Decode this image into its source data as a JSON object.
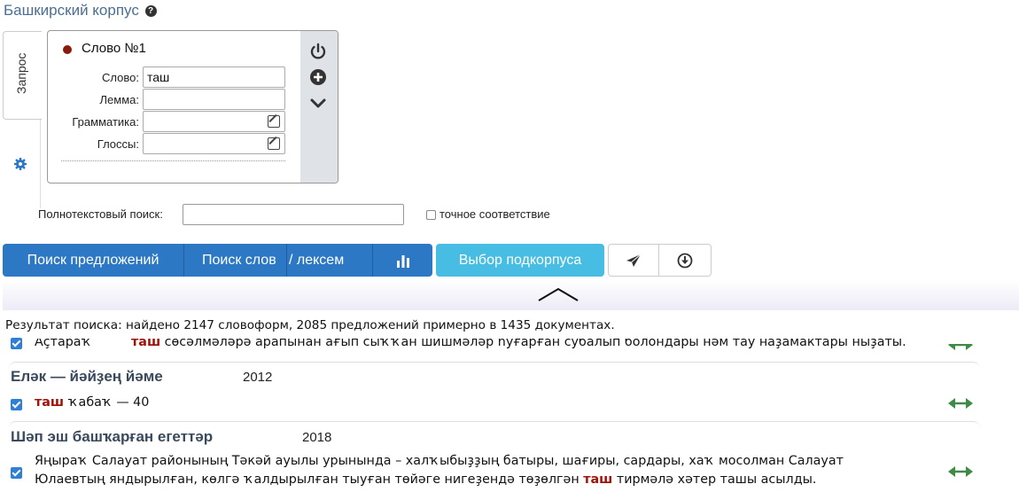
{
  "header": {
    "title": "Башкирский корпус",
    "help_icon": "question-circle-icon"
  },
  "tabs": [
    {
      "label": "Запрос",
      "active": true
    },
    {
      "label": "",
      "icon": "gear-icon"
    }
  ],
  "word_box": {
    "header": "Слово №1",
    "marker_color": "#8b1a0e",
    "fields": [
      {
        "label": "Слово:",
        "value": "таш",
        "has_edit": false
      },
      {
        "label": "Лемма:",
        "value": "",
        "has_edit": false
      },
      {
        "label": "Грамматика:",
        "value": "",
        "has_edit": true
      },
      {
        "label": "Глоссы:",
        "value": "",
        "has_edit": true
      }
    ],
    "side_icons": [
      "power-icon",
      "plus-circle-icon",
      "chevron-down-icon"
    ]
  },
  "fulltext": {
    "label": "Полнотекстовый поиск:",
    "value": "",
    "exact_label": "точное соответствие",
    "exact_checked": false
  },
  "toolbar": {
    "search_sentences": "Поиск предложений",
    "search_words_a": "Поиск слов",
    "search_words_b": "/ лексем",
    "stats_icon": "bar-chart-icon",
    "subcorpus": "Выбор подкорпуса",
    "share_icon": "paper-plane-icon",
    "download_icon": "download-circle-icon",
    "colors": {
      "primary": "#2d78c5",
      "info": "#47bde3"
    }
  },
  "result_summary": "Результат поиска: найдено 2147 словоформ, 2085 предложений примерно в 1435 документах.",
  "results": {
    "partial_line": {
      "before": "Аҫтараҡ",
      "hit": "таш",
      "after": " сөсәлмәләрә арапынан ағып сыҡҡан шишмәләр һуғарған субалып болондары нәм тау наҙамактары ныҙаты."
    },
    "docs": [
      {
        "title": "Еләк — йәйҙең йәме",
        "year": "2012",
        "lines": [
          {
            "before": "",
            "hit": "таш",
            "after": " ҡабаҡ — 40"
          }
        ]
      },
      {
        "title": "Шәп эш башҡарған егеттәр",
        "year": "2018",
        "lines": [
          {
            "before": "Яңыраҡ Салауат районының Тәкәй ауылы урынында – халҡыбыҙҙың батыры, шағиры, сардары, хаҡ мосолман Салауат",
            "hit": "",
            "after": ""
          },
          {
            "before": "Юлаевтың яндырылған, көлгә ҡалдырылған тыуған төйәге нигеҙендә төҙөлгән ",
            "hit": "таш",
            "after": " тирмәлә хәтер ташы асылды."
          }
        ]
      }
    ]
  }
}
